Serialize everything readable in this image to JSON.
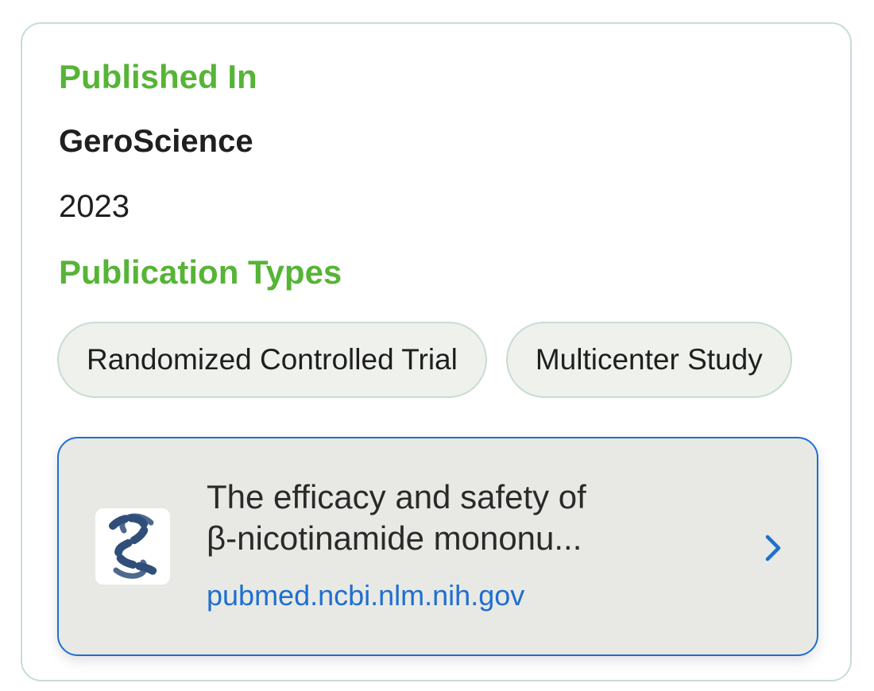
{
  "colors": {
    "heading_green": "#56b436",
    "link_blue": "#1e6fd0",
    "chevron_blue": "#1e6fd0"
  },
  "published_in": {
    "heading": "Published In",
    "journal": "GeroScience",
    "year": "2023"
  },
  "publication_types": {
    "heading": "Publication Types",
    "chips": [
      {
        "label": "Randomized Controlled Trial"
      },
      {
        "label": "Multicenter Study"
      }
    ]
  },
  "link_card": {
    "favicon": "pubmed-icon",
    "title_line1": "The efficacy and safety of",
    "title_line2": "β-nicotinamide mononu...",
    "domain": "pubmed.ncbi.nlm.nih.gov",
    "chevron": "chevron-right-icon"
  }
}
